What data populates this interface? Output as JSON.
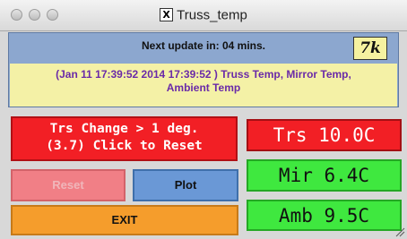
{
  "window": {
    "title": "Truss_temp",
    "app_icon": "x-window-icon"
  },
  "status": {
    "next_update": "Next update in: 04 mins.",
    "logo_text": "7k",
    "message_line1": "(Jan 11 17:39:52 2014 17:39:52 ) Truss Temp, Mirror Temp,",
    "message_line2": "Ambient Temp"
  },
  "controls": {
    "alert_line1": "Trs Change > 1 deg.",
    "alert_line2": "(3.7) Click to Reset",
    "reset_label": "Reset",
    "plot_label": "Plot",
    "exit_label": "EXIT"
  },
  "readouts": {
    "truss": "Trs 10.0C",
    "mirror": "Mir 6.4C",
    "ambient": "Amb 9.5C"
  },
  "colors": {
    "alert": "#f21f25",
    "ok": "#3fe83f",
    "panel": "#8ca7cf",
    "message_bg": "#f4f1a6",
    "exit": "#f59d2c",
    "plot": "#6a98d6"
  }
}
